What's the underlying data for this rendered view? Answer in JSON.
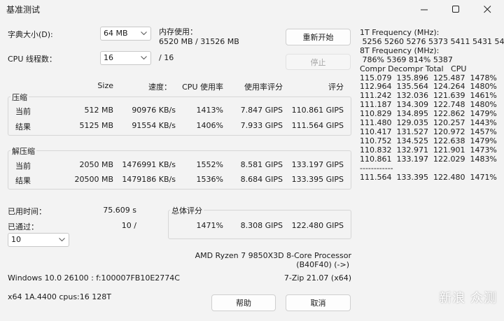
{
  "window": {
    "title": "基准测试"
  },
  "dictionary": {
    "label": "字典大小(D):",
    "value": "64 MB"
  },
  "memory": {
    "label": "内存使用：",
    "value": "6520 MB / 31526 MB"
  },
  "threads": {
    "label": "CPU 线程数：",
    "value": "16",
    "total": "/ 16"
  },
  "buttons": {
    "restart": "重新开始",
    "stop": "停止",
    "help": "帮助",
    "cancel": "取消"
  },
  "columns": {
    "size": "Size",
    "speed": "速度：",
    "cpu_usage": "CPU 使用率",
    "rating_per_usage": "使用率评分",
    "rating": "评分"
  },
  "compress": {
    "label": "压缩",
    "rows": [
      {
        "label": "当前",
        "size": "512 MB",
        "speed": "90976 KB/s",
        "usage": "1413%",
        "rpu": "7.847 GIPS",
        "rating": "110.861 GIPS"
      },
      {
        "label": "结果",
        "size": "5125 MB",
        "speed": "91554 KB/s",
        "usage": "1406%",
        "rpu": "7.933 GIPS",
        "rating": "111.564 GIPS"
      }
    ]
  },
  "decompress": {
    "label": "解压缩",
    "rows": [
      {
        "label": "当前",
        "size": "2050 MB",
        "speed": "1476991 KB/s",
        "usage": "1552%",
        "rpu": "8.581 GIPS",
        "rating": "133.197 GIPS"
      },
      {
        "label": "结果",
        "size": "20500 MB",
        "speed": "1479186 KB/s",
        "usage": "1536%",
        "rpu": "8.684 GIPS",
        "rating": "133.395 GIPS"
      }
    ]
  },
  "elapsed": {
    "label": "已用时间：",
    "value": "75.609 s"
  },
  "passes": {
    "label": "已通过：",
    "value": "10 /",
    "select": "10"
  },
  "total": {
    "label": "总体评分",
    "usage": "1471%",
    "rpu": "8.308 GIPS",
    "rating": "122.480 GIPS"
  },
  "cpu": {
    "name": "AMD Ryzen 7 9850X3D 8-Core Processor",
    "id": "(B40F40) (->)"
  },
  "sys": {
    "os": "Windows 10.0 26100 :  f:100007FB10E2774C",
    "zip": "7-Zip 21.07 (x64)",
    "arch": "x64 1A.4400 cpus:16 128T"
  },
  "log": {
    "lines": [
      "1T Frequency (MHz):",
      " 5256 5260 5276 5373 5411 5431 5497",
      "8T Frequency (MHz):",
      " 786% 5369 814% 5387",
      "Compr Decompr Total   CPU",
      "115.079  135.896  125.487  1478%",
      "112.964  135.564  124.264  1480%",
      "111.242  132.036  121.639  1461%",
      "111.187  134.309  122.748  1480%",
      "110.829  134.895  122.862  1479%",
      "111.480  129.035  120.257  1443%",
      "110.417  131.527  120.972  1457%",
      "110.752  134.525  122.638  1479%",
      "110.832  132.971  121.901  1473%",
      "110.861  133.197  122.029  1483%",
      "------------",
      "111.564  133.395  122.480  1471%"
    ]
  },
  "watermark": "新浪 众测"
}
